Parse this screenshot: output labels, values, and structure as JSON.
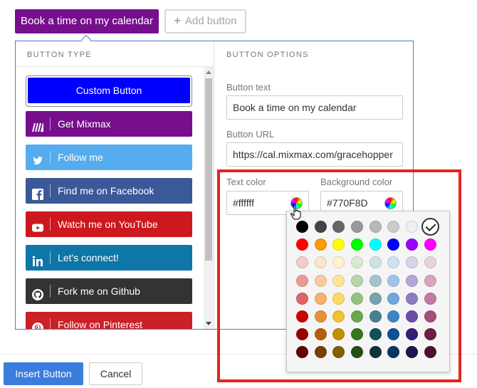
{
  "tabs": {
    "active_label": "Book a time on my calendar",
    "add_label": "Add button",
    "active_color": "#770F8D"
  },
  "button_type": {
    "heading": "BUTTON TYPE",
    "custom_label": "Custom Button",
    "items": [
      {
        "label": "Get Mixmax",
        "icon": "mixmax-icon",
        "color": "#770F8D"
      },
      {
        "label": "Follow me",
        "icon": "twitter-icon",
        "color": "#55ACEE"
      },
      {
        "label": "Find me on Facebook",
        "icon": "facebook-icon",
        "color": "#3B5998"
      },
      {
        "label": "Watch me on YouTube",
        "icon": "youtube-icon",
        "color": "#CC181E"
      },
      {
        "label": "Let's connect!",
        "icon": "linkedin-icon",
        "color": "#0E76A8"
      },
      {
        "label": "Fork me on Github",
        "icon": "github-icon",
        "color": "#333333"
      },
      {
        "label": "Follow on Pinterest",
        "icon": "pinterest-icon",
        "color": "#CB2027"
      }
    ]
  },
  "button_options": {
    "heading": "BUTTON OPTIONS",
    "text_label": "Button text",
    "text_value": "Book a time on my calendar",
    "url_label": "Button URL",
    "url_value": "https://cal.mixmax.com/gracehopper",
    "text_color_label": "Text color",
    "text_color_value": "#ffffff",
    "bg_color_label": "Background color",
    "bg_color_value": "#770F8D"
  },
  "color_picker": {
    "selected_color": "#ffffff",
    "colors": [
      "#000000",
      "#434343",
      "#666666",
      "#999999",
      "#b7b7b7",
      "#cccccc",
      "#efefef",
      "#ffffff",
      "#ff0000",
      "#ff9900",
      "#ffff00",
      "#00ff00",
      "#00ffff",
      "#0000ff",
      "#9900ff",
      "#ff00ff",
      "#f4cccc",
      "#fce5cd",
      "#fff2cc",
      "#d9ead3",
      "#d0e0e3",
      "#cfe2f3",
      "#d9d2e9",
      "#ead1dc",
      "#ea9999",
      "#f9cb9c",
      "#ffe599",
      "#b6d7a8",
      "#a2c4c9",
      "#9fc5e8",
      "#b4a7d6",
      "#d5a6bd",
      "#e06666",
      "#f6b26b",
      "#ffd966",
      "#93c47d",
      "#76a5af",
      "#6fa8dc",
      "#8e7cc3",
      "#c27ba0",
      "#cc0000",
      "#e69138",
      "#f1c232",
      "#6aa84f",
      "#45818e",
      "#3d85c6",
      "#674ea7",
      "#a64d79",
      "#990000",
      "#b45f06",
      "#bf9000",
      "#38761d",
      "#134f5c",
      "#0b5394",
      "#351c75",
      "#741b47",
      "#660000",
      "#783f04",
      "#7f6000",
      "#274e13",
      "#0c343d",
      "#073763",
      "#20124d",
      "#4c1130"
    ]
  },
  "footer": {
    "insert_label": "Insert Button",
    "cancel_label": "Cancel"
  }
}
